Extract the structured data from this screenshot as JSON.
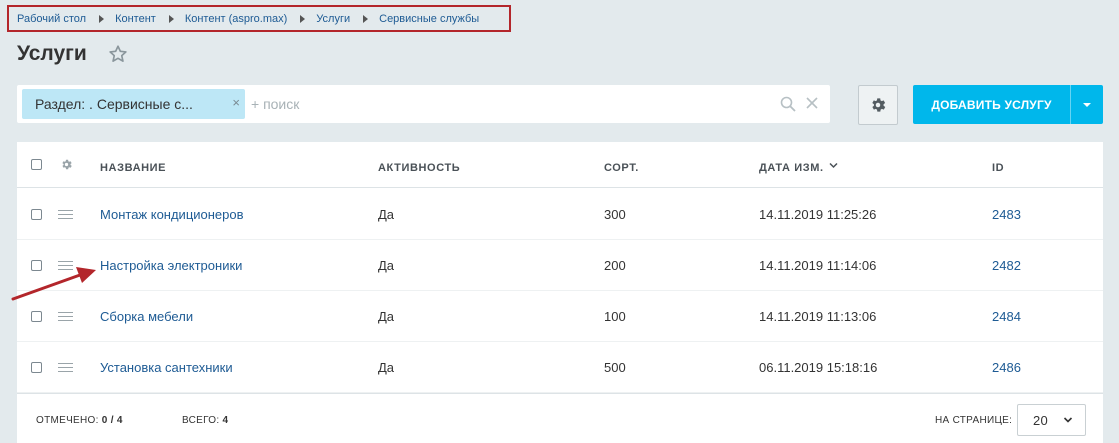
{
  "breadcrumb": [
    "Рабочий стол",
    "Контент",
    "Контент (aspro.max)",
    "Услуги",
    "Сервисные службы"
  ],
  "page": {
    "title": "Услуги"
  },
  "filter": {
    "tag": "Раздел: . Сервисные с...",
    "tag_close": "×",
    "search_placeholder": "+ поиск"
  },
  "toolbar": {
    "add_label": "ДОБАВИТЬ УСЛУГУ"
  },
  "grid": {
    "columns": {
      "name": "НАЗВАНИЕ",
      "active": "АКТИВНОСТЬ",
      "sort": "СОРТ.",
      "date": "ДАТА ИЗМ.",
      "id": "ID"
    },
    "rows": [
      {
        "name": "Монтаж кондиционеров",
        "active": "Да",
        "sort": "300",
        "date": "14.11.2019 11:25:26",
        "id": "2483"
      },
      {
        "name": "Настройка электроники",
        "active": "Да",
        "sort": "200",
        "date": "14.11.2019 11:14:06",
        "id": "2482"
      },
      {
        "name": "Сборка мебели",
        "active": "Да",
        "sort": "100",
        "date": "14.11.2019 11:13:06",
        "id": "2484"
      },
      {
        "name": "Установка сантехники",
        "active": "Да",
        "sort": "500",
        "date": "06.11.2019 15:18:16",
        "id": "2486"
      }
    ]
  },
  "footer": {
    "selected_label": "ОТМЕЧЕНО:",
    "selected_value": "0 / 4",
    "total_label": "ВСЕГО:",
    "total_value": "4",
    "per_page_label": "НА СТРАНИЦЕ:",
    "per_page_value": "20"
  },
  "colors": {
    "accent": "#00b7eb",
    "link": "#1e5b94",
    "highlight": "#b3262b",
    "filter_tag": "#bde7f6"
  },
  "icons": [
    "star-icon",
    "search-icon",
    "clear-icon",
    "gear-icon",
    "chevron-down-icon",
    "drag-handle-icon",
    "sort-desc-icon"
  ]
}
